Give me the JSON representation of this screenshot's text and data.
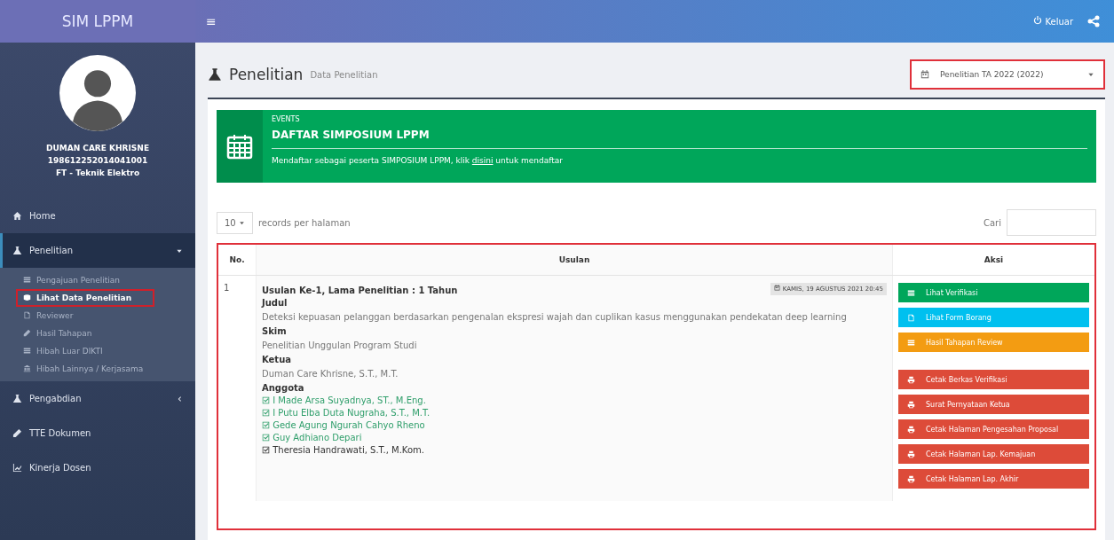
{
  "brand": "SIM LPPM",
  "user": {
    "name": "DUMAN CARE KHRISNE",
    "id": "198612252014041001",
    "unit": "FT - Teknik Elektro"
  },
  "menu": [
    {
      "label": "Home",
      "expanded": false,
      "has_children": false
    },
    {
      "label": "Penelitian",
      "expanded": true,
      "has_children": true,
      "children": [
        {
          "label": "Pengajuan Penelitian",
          "selected": false
        },
        {
          "label": "Lihat Data Penelitian",
          "selected": true
        },
        {
          "label": "Reviewer",
          "selected": false
        },
        {
          "label": "Hasil Tahapan",
          "selected": false
        },
        {
          "label": "Hibah Luar DIKTI",
          "selected": false
        },
        {
          "label": "Hibah Lainnya / Kerjasama",
          "selected": false
        }
      ]
    },
    {
      "label": "Pengabdian",
      "expanded": false,
      "has_children": true
    },
    {
      "label": "TTE Dokumen",
      "expanded": false,
      "has_children": false
    },
    {
      "label": "Kinerja Dosen",
      "expanded": false,
      "has_children": false
    }
  ],
  "topbar": {
    "menu_toggle": "≡",
    "logout": "Keluar"
  },
  "page": {
    "title": "Penelitian",
    "subtitle": "Data Penelitian",
    "period": "Penelitian TA 2022 (2022)"
  },
  "banner": {
    "overline": "EVENTS",
    "title": "DAFTAR SIMPOSIUM LPPM",
    "text_before": "Mendaftar sebagai peserta SIMPOSIUM LPPM, klik",
    "link": "disini",
    "text_after": "untuk mendaftar"
  },
  "table_controls": {
    "page_size": "10",
    "page_size_label": "records per halaman",
    "search_label": "Cari"
  },
  "table": {
    "columns": [
      "No.",
      "Usulan",
      "Aksi"
    ],
    "rows": [
      {
        "no": "1",
        "heading": "Usulan Ke-1, Lama Penelitian : 1 Tahun",
        "date_badge": "KAMIS, 19 AGUSTUS 2021 20:45",
        "fields": [
          {
            "label": "Judul",
            "value": "Deteksi kepuasan pelanggan berdasarkan pengenalan ekspresi wajah dan cuplikan kasus menggunakan pendekatan deep learning"
          },
          {
            "label": "Skim",
            "value": "Penelitian Unggulan Program Studi"
          },
          {
            "label": "Ketua",
            "value": "Duman Care Khrisne, S.T., M.T."
          }
        ],
        "members_label": "Anggota",
        "members": [
          {
            "name": "I Made Arsa Suyadnya, ST., M.Eng.",
            "confirmed": true
          },
          {
            "name": "I Putu Elba Duta Nugraha, S.T., M.T.",
            "confirmed": true
          },
          {
            "name": "Gede Agung Ngurah Cahyo Rheno",
            "confirmed": true
          },
          {
            "name": "Guy Adhiano Depari",
            "confirmed": true
          },
          {
            "name": "Theresia Handrawati, S.T., M.Kom.",
            "confirmed": false
          }
        ],
        "actions": [
          {
            "label": "Lihat Verifikasi",
            "kind": "success"
          },
          {
            "label": "Lihat Form Borang",
            "kind": "info"
          },
          {
            "label": "Hasil Tahapan Review",
            "kind": "warning"
          },
          {
            "label": "Cetak Berkas Verifikasi",
            "kind": "danger"
          },
          {
            "label": "Surat Pernyataan Ketua",
            "kind": "danger"
          },
          {
            "label": "Cetak Halaman Pengesahan Proposal",
            "kind": "danger"
          },
          {
            "label": "Cetak Halaman Lap. Kemajuan",
            "kind": "danger"
          },
          {
            "label": "Cetak Halaman Lap. Akhir",
            "kind": "danger"
          }
        ]
      }
    ]
  }
}
